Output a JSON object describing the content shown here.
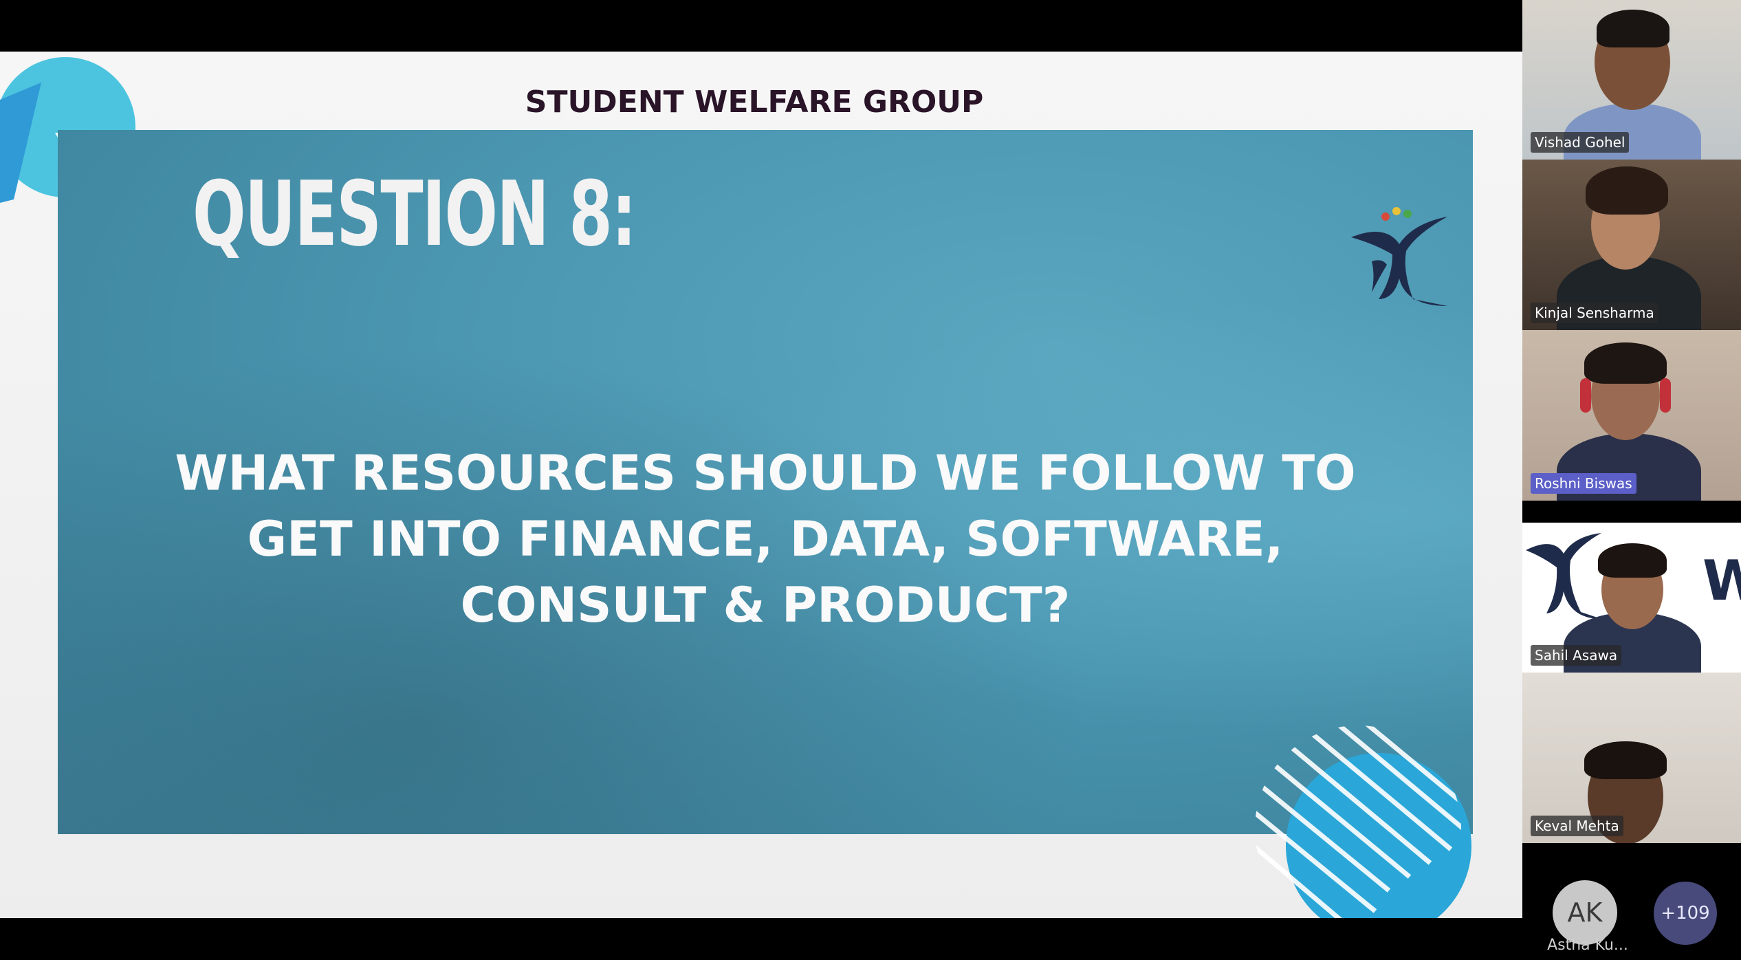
{
  "slide": {
    "header": "STUDENT WELFARE GROUP",
    "question_title": "QUESTION 8:",
    "question_lines": [
      "WHAT RESOURCES SHOULD WE FOLLOW TO",
      "GET INTO FINANCE, DATA, SOFTWARE,",
      "CONSULT & PRODUCT?"
    ],
    "logo_icon": "swg-logo-icon",
    "decor_icon": "striped-circle-icon"
  },
  "participants": [
    {
      "name": "Vishad Gohel",
      "highlight": false
    },
    {
      "name": "Kinjal Sensharma",
      "highlight": false
    },
    {
      "name": "Roshni Biswas",
      "highlight": true
    },
    {
      "name": "Sahil Asawa",
      "highlight": false
    },
    {
      "name": "Keval Mehta",
      "highlight": false
    }
  ],
  "overflow": {
    "avatar_initials": "AK",
    "avatar_name": "Astha Ku...",
    "more_count": "+109"
  },
  "colors": {
    "panel": "#4c97b2",
    "header_text": "#2a1428",
    "highlight_tag": "#5b5fc7"
  }
}
